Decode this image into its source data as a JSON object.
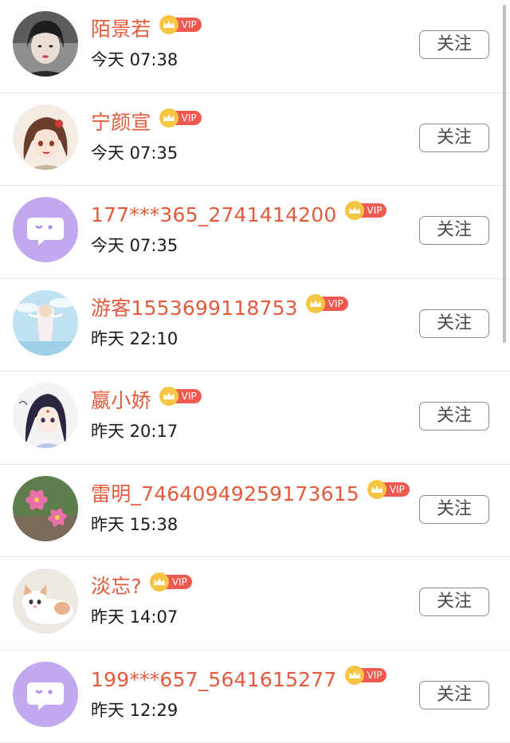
{
  "follow_label": "关注",
  "vip_label": "VIP",
  "users": [
    {
      "name": "陌景若",
      "time": "今天 07:38",
      "avatar": "avatar-photo-woman"
    },
    {
      "name": "宁颜宣",
      "time": "今天 07:35",
      "avatar": "avatar-anime-girl"
    },
    {
      "name": "177***365_2741414200",
      "time": "今天 07:35",
      "avatar": "avatar-default-chat"
    },
    {
      "name": "游客1553699118753",
      "time": "昨天 22:10",
      "avatar": "avatar-sky-angel"
    },
    {
      "name": "嬴小娇",
      "time": "昨天 20:17",
      "avatar": "avatar-anime-girl-dark"
    },
    {
      "name": "雷明_74640949259173615",
      "time": "昨天 15:38",
      "avatar": "avatar-pink-lily"
    },
    {
      "name": "淡忘?",
      "time": "昨天 14:07",
      "avatar": "avatar-kitten"
    },
    {
      "name": "199***657_5641615277",
      "time": "昨天 12:29",
      "avatar": "avatar-default-chat"
    }
  ],
  "colors": {
    "name": "#e35a3c",
    "vip_crown": "#f6c544",
    "vip_tag": "#ee5a50",
    "default_avatar": "#c4a8ef"
  }
}
